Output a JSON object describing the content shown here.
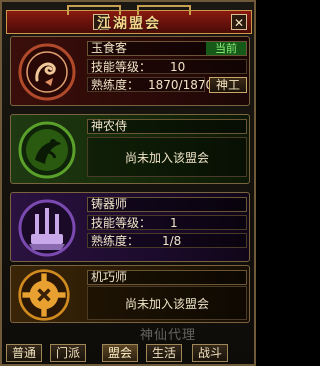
{
  "window": {
    "title": "江湖盟会",
    "help_label": "?",
    "close_label": "✕"
  },
  "guilds": [
    {
      "name": "玉食客",
      "status_tag": "当前",
      "skill_label": "技能等级：",
      "skill_value": "10",
      "prof_label": "熟练度：",
      "prof_value": "1870/1870",
      "button_label": "神工",
      "emblem": "dragon-emblem-icon",
      "color": "#7a1a12"
    },
    {
      "name": "神农侍",
      "message": "尚未加入该盟会",
      "emblem": "herb-emblem-icon",
      "color": "#3f7a1c"
    },
    {
      "name": "铸器师",
      "skill_label": "技能等级：",
      "skill_value": "1",
      "prof_label": "熟练度：",
      "prof_value": "1/8",
      "emblem": "forge-emblem-icon",
      "color": "#5a2a80"
    },
    {
      "name": "机巧师",
      "message": "尚未加入该盟会",
      "emblem": "gear-emblem-icon",
      "color": "#c07a1a"
    }
  ],
  "tabs": [
    {
      "label": "普通"
    },
    {
      "label": "门派"
    },
    {
      "label": "盟会"
    },
    {
      "label": "生活"
    },
    {
      "label": "战斗"
    }
  ],
  "active_tab": "盟会",
  "watermark": "神仙代理"
}
